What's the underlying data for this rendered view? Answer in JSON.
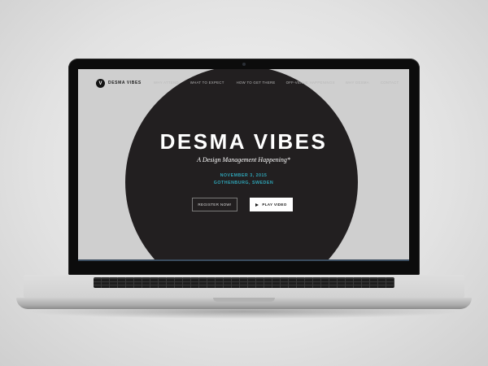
{
  "site": {
    "logo_letter": "V",
    "logo_text": "DESMA VIBES"
  },
  "nav": {
    "items": [
      "WHY ATTEND",
      "WHAT TO EXPECT",
      "HOW TO GET THERE",
      "OFF-VENUE HAPPENINGS",
      "WHY DESMA",
      "CONTACT"
    ]
  },
  "hero": {
    "title": "DESMA VIBES",
    "tagline": "A Design Management Happening*",
    "date": "NOVEMBER 3, 2015",
    "location": "GOTHENBURG, SWEDEN",
    "register_label": "REGISTER NOW!",
    "play_label": "PLAY VIDEO"
  },
  "colors": {
    "accent": "#2fa4b6",
    "circle": "#221f20",
    "screen_bg": "#cfcfcf"
  }
}
